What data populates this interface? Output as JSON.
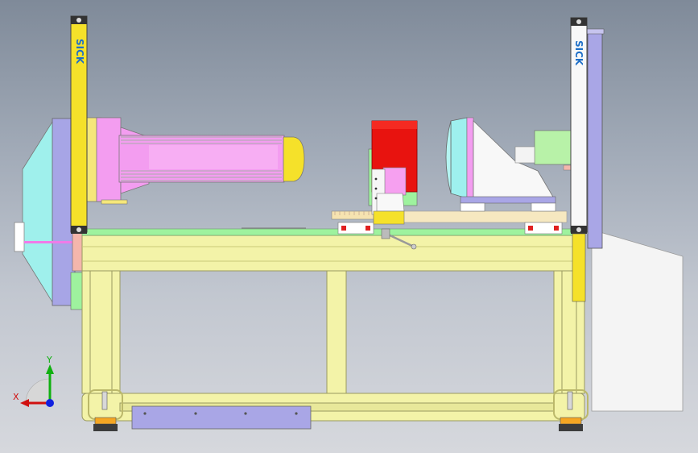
{
  "viewport": {
    "background_top": "#7f8a99",
    "background_bottom": "#d6d8dd"
  },
  "brand": {
    "left_tower_label": "SICK",
    "right_tower_label": "SICK"
  },
  "triad": {
    "x_label": "X",
    "y_label": "Y",
    "x_color": "#d01010",
    "y_color": "#10b010",
    "z_color": "#1020e0"
  },
  "colors": {
    "frame": "#f3f3a8",
    "tower": "#f5e12a",
    "cylinder": "#f39df0",
    "red_block": "#e8130f",
    "cyan_shield": "#9ef0ee",
    "lavender": "#a9a6e6",
    "green_rail": "#9ef29e"
  }
}
